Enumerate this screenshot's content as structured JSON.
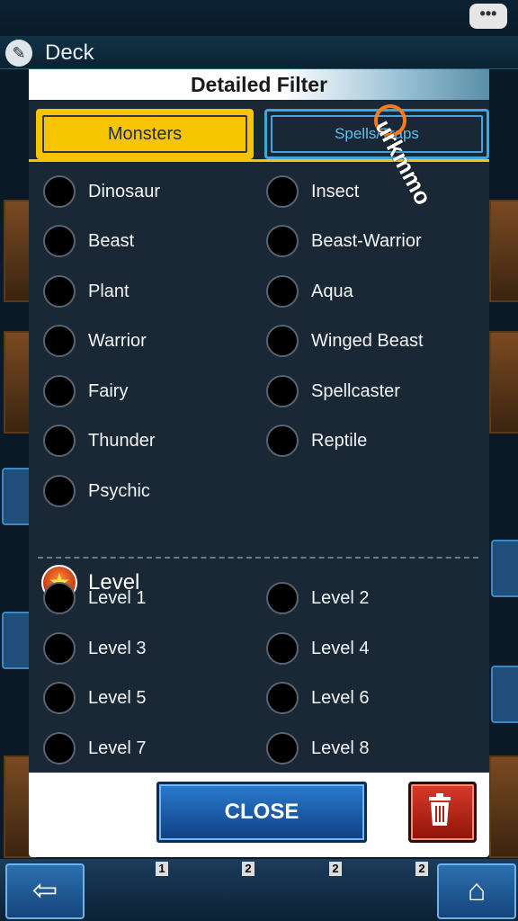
{
  "background": {
    "deck_title": "Deck",
    "count_badges": [
      "1",
      "2",
      "2",
      "2"
    ],
    "back_icon": "left-arrow-icon",
    "home_icon": "home-icon",
    "chat_icon": "chat-bubble-icon"
  },
  "dialog": {
    "title": "Detailed Filter",
    "tabs": [
      {
        "label": "Monsters",
        "active": true
      },
      {
        "label": "Spells/Traps",
        "active": false
      }
    ],
    "types": [
      {
        "label": "Dinosaur"
      },
      {
        "label": "Insect"
      },
      {
        "label": "Beast"
      },
      {
        "label": "Beast-Warrior"
      },
      {
        "label": "Plant"
      },
      {
        "label": "Aqua"
      },
      {
        "label": "Warrior"
      },
      {
        "label": "Winged Beast"
      },
      {
        "label": "Fairy"
      },
      {
        "label": "Spellcaster"
      },
      {
        "label": "Thunder"
      },
      {
        "label": "Reptile"
      },
      {
        "label": "Psychic"
      }
    ],
    "level_heading": "Level",
    "levels": [
      {
        "label": "Level 1"
      },
      {
        "label": "Level 2"
      },
      {
        "label": "Level 3"
      },
      {
        "label": "Level 4"
      },
      {
        "label": "Level 5"
      },
      {
        "label": "Level 6"
      },
      {
        "label": "Level 7"
      },
      {
        "label": "Level 8"
      }
    ],
    "close_label": "CLOSE",
    "colors": {
      "tab_active": "#f7c400",
      "tab_inactive": "#3fa7e0",
      "close": "#2a7bd0",
      "trash": "#d93a2a"
    }
  },
  "watermark": "urkmmo"
}
